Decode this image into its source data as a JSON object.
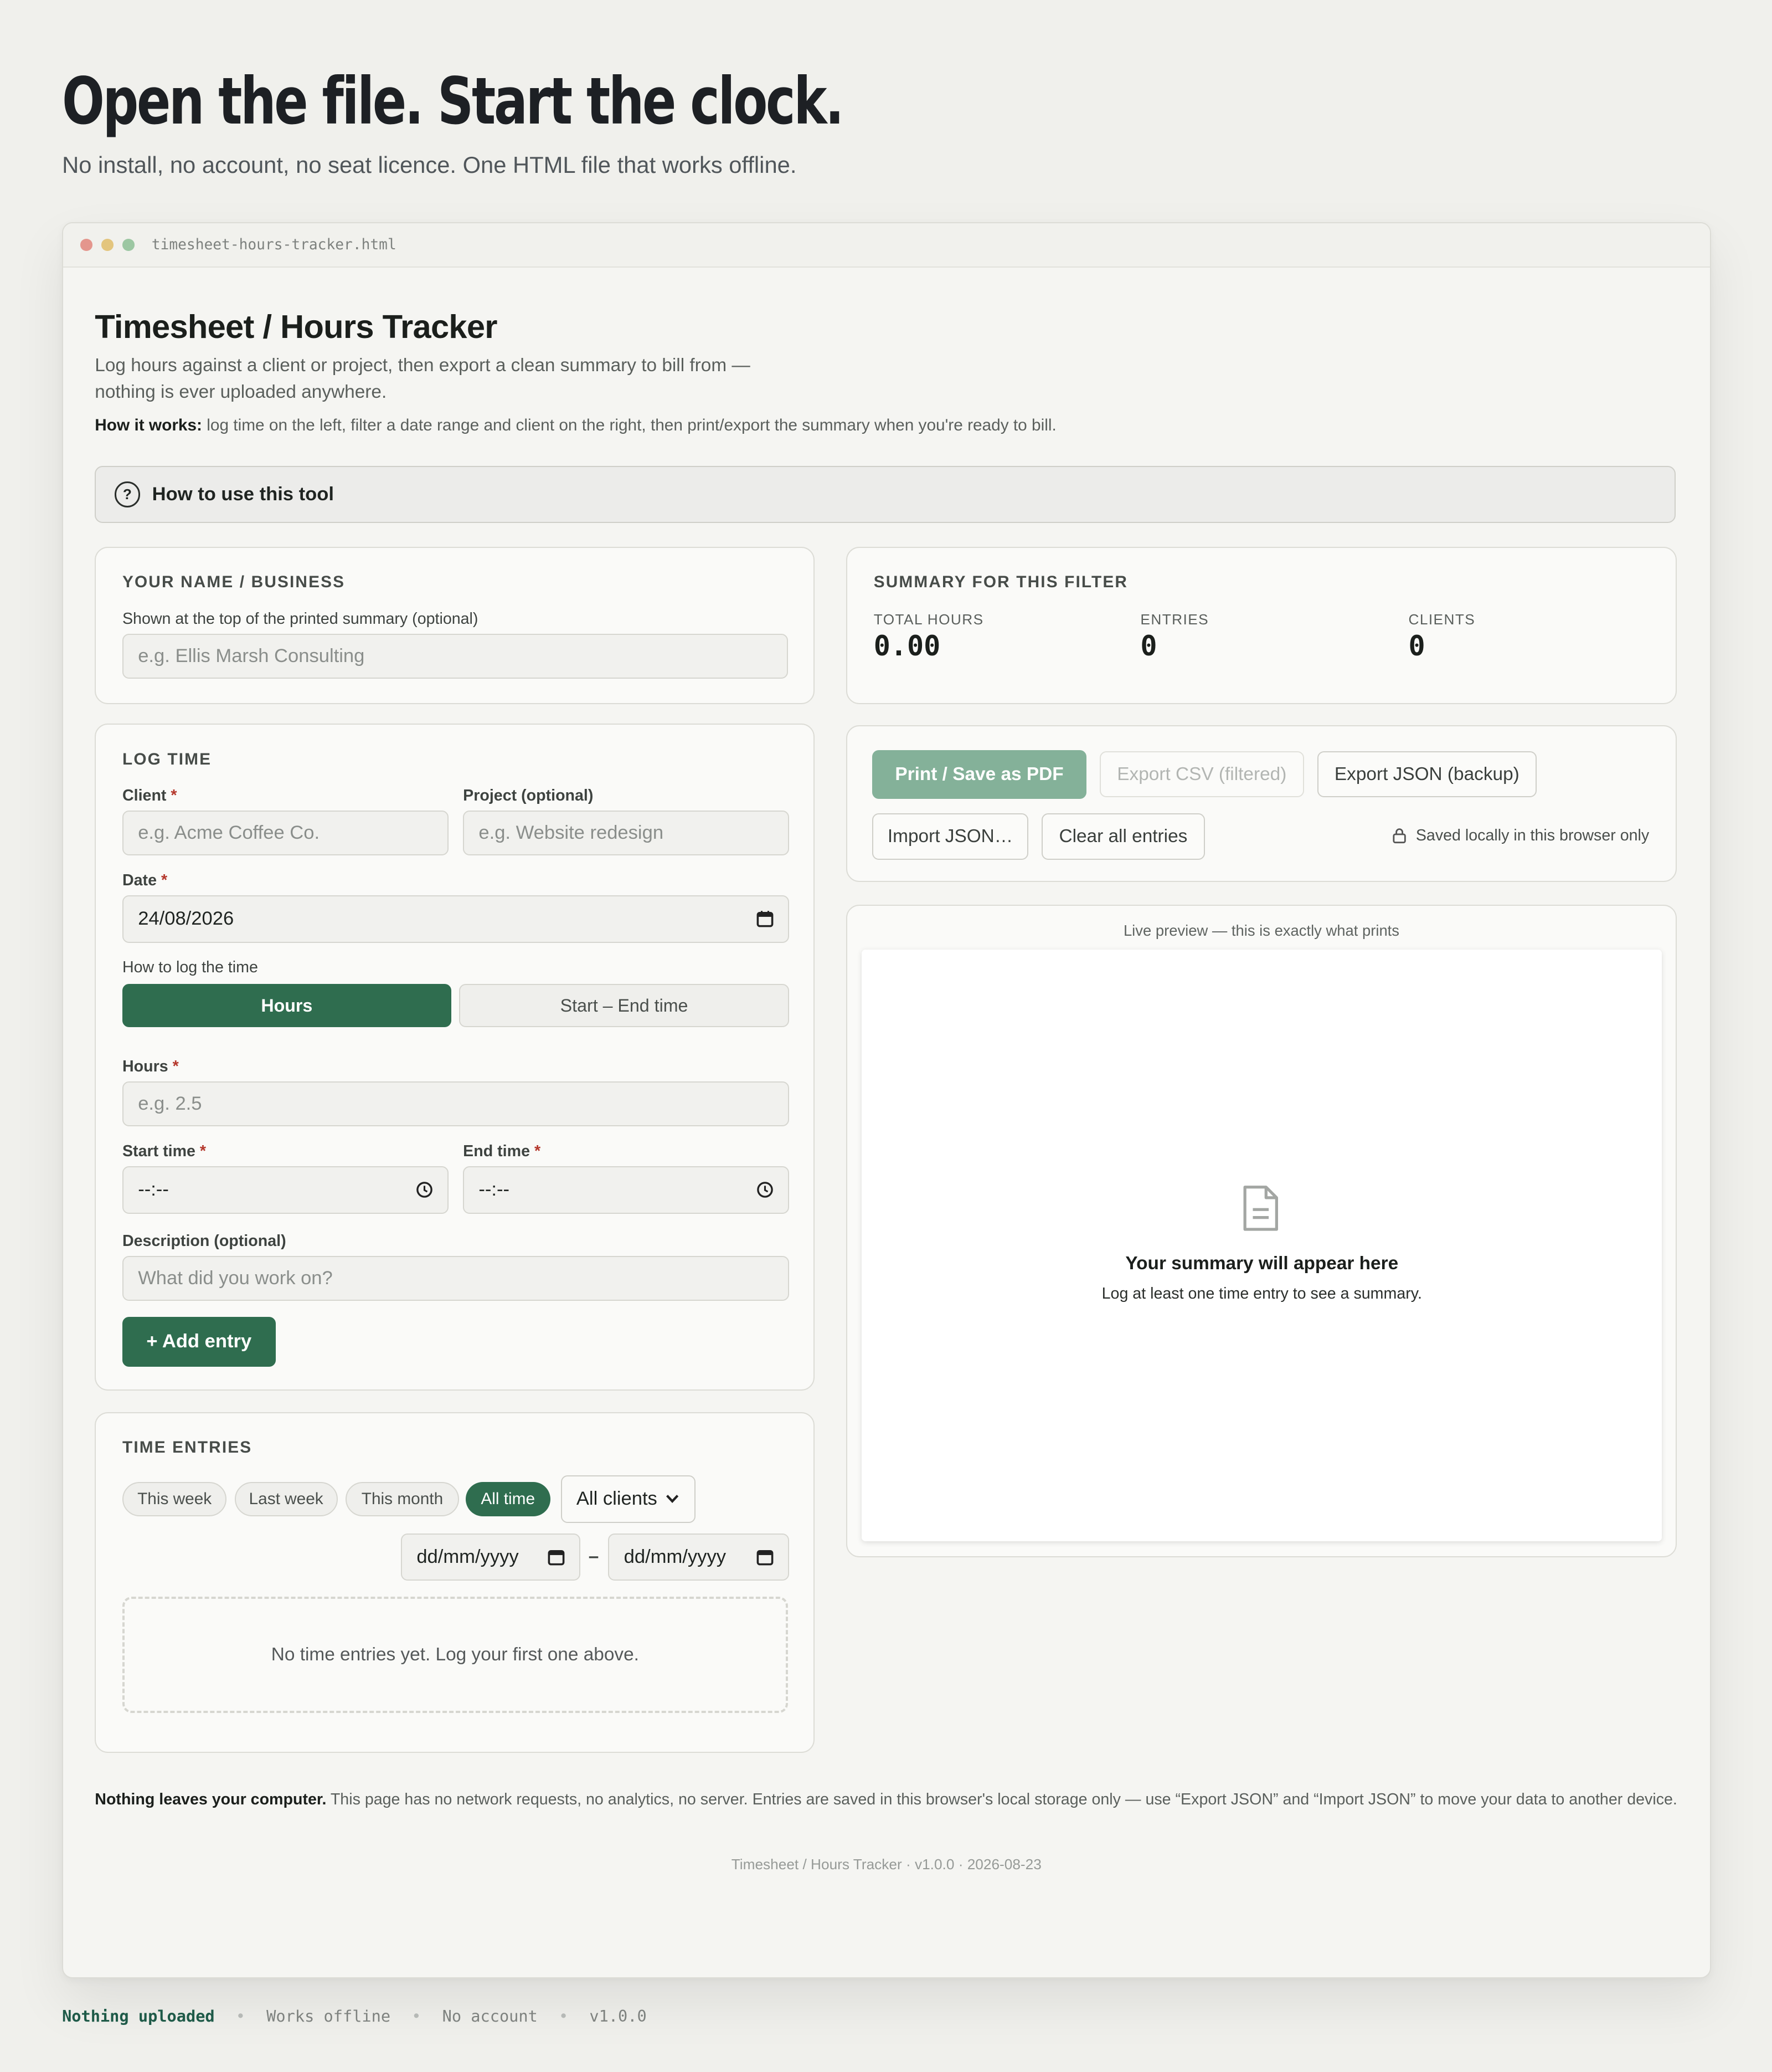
{
  "hero": {
    "title": "Open the file. Start the clock.",
    "subtitle": "No install, no account, no seat licence. One HTML file that works offline."
  },
  "window": {
    "filename": "timesheet-hours-tracker.html"
  },
  "app": {
    "title": "Timesheet / Hours Tracker",
    "description": "Log hours against a client or project, then export a clean summary to bill from — nothing is ever uploaded anywhere.",
    "how_label": "How it works:",
    "how_text": "log time on the left, filter a date range and client on the right, then print/export the summary when you're ready to bill.",
    "help_toggle": "How to use this tool",
    "help_icon": "?"
  },
  "business": {
    "title": "YOUR NAME / BUSINESS",
    "label": "Shown at the top of the printed summary (optional)",
    "placeholder": "e.g. Ellis Marsh Consulting",
    "value": ""
  },
  "log_time": {
    "title": "LOG TIME",
    "client_label": "Client",
    "client_placeholder": "e.g. Acme Coffee Co.",
    "project_label": "Project (optional)",
    "project_placeholder": "e.g. Website redesign",
    "date_label": "Date",
    "date_value": "24/08/2026",
    "mode_label": "How to log the time",
    "mode_hours": "Hours",
    "mode_start_end": "Start – End time",
    "mode_selected": "Hours",
    "hours_label": "Hours",
    "hours_placeholder": "e.g. 2.5",
    "start_label": "Start time",
    "start_value": "--:--",
    "end_label": "End time",
    "end_value": "--:--",
    "desc_label": "Description (optional)",
    "desc_placeholder": "What did you work on?",
    "required_mark": "*",
    "add_button": "+ Add entry"
  },
  "time_entries": {
    "title": "TIME ENTRIES",
    "filters": [
      "This week",
      "Last week",
      "This month",
      "All time"
    ],
    "active_filter": "All time",
    "client_select": "All clients",
    "date_from": "dd/mm/yyyy",
    "date_sep": "–",
    "date_to": "dd/mm/yyyy",
    "empty_text": "No time entries yet. Log your first one above."
  },
  "summary": {
    "title": "SUMMARY FOR THIS FILTER",
    "total_hours_label": "TOTAL HOURS",
    "total_hours": "0.00",
    "entries_label": "ENTRIES",
    "entries": "0",
    "clients_label": "CLIENTS",
    "clients": "0"
  },
  "actions": {
    "print": "Print / Save as PDF",
    "export_csv": "Export CSV (filtered)",
    "export_json": "Export JSON (backup)",
    "import_json": "Import JSON…",
    "clear": "Clear all entries",
    "saved_note": "Saved locally in this browser only"
  },
  "preview": {
    "caption": "Live preview — this is exactly what prints",
    "empty_title": "Your summary will appear here",
    "empty_sub": "Log at least one time entry to see a summary."
  },
  "privacy": {
    "bold": "Nothing leaves your computer.",
    "text": "This page has no network requests, no analytics, no server. Entries are saved in this browser's local storage only — use “Export JSON” and “Import JSON” to move your data to another device."
  },
  "version_line": "Timesheet / Hours Tracker · v1.0.0 · 2026-08-23",
  "footer": {
    "items": [
      "Nothing uploaded",
      "Works offline",
      "No account",
      "v1.0.0"
    ],
    "separator": "•"
  },
  "colors": {
    "accent": "#2f6d4f",
    "accent_muted": "#84b199",
    "required": "#b4372c",
    "page_bg": "#f0f0ec"
  },
  "icons": [
    "help-icon",
    "calendar-icon",
    "clock-icon",
    "lock-icon",
    "document-icon",
    "chevron-down-icon"
  ]
}
